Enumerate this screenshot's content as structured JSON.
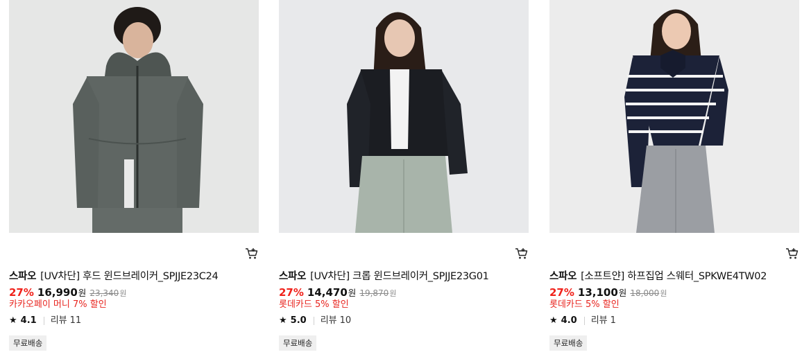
{
  "products": [
    {
      "brand": "스파오",
      "name": "[UV차단] 후드 윈드브레이커_SPJJE23C24",
      "discount": "27%",
      "price": "16,990",
      "currency": "원",
      "original_price": "23,340",
      "original_currency": "원",
      "promo": "카카오페이 머니 7% 할인",
      "rating": "4.1",
      "review_label": "리뷰",
      "review_count": "11",
      "badge": "무료배송",
      "image_desc": "man in grey hooded windbreaker",
      "colors": {
        "bg": "#e6e7e6",
        "jacket": "#5f6663",
        "pants": "#646b68",
        "skin": "#d9b49c",
        "hair": "#1f1a17"
      }
    },
    {
      "brand": "스파오",
      "name": "[UV차단] 크롭 윈드브레이커_SPJJE23G01",
      "discount": "27%",
      "price": "14,470",
      "currency": "원",
      "original_price": "19,870",
      "original_currency": "원",
      "promo": "롯데카드 5% 할인",
      "rating": "5.0",
      "review_label": "리뷰",
      "review_count": "10",
      "badge": "무료배송",
      "image_desc": "woman in black cropped windbreaker",
      "colors": {
        "bg": "#e8e9eb",
        "jacket": "#1b1d22",
        "pants": "#a8b4aa",
        "skin": "#e7c7b3",
        "hair": "#2a1d17"
      }
    },
    {
      "brand": "스파오",
      "name": "[소프트얀] 하프집업 스웨터_SPKWE4TW02",
      "discount": "27%",
      "price": "13,100",
      "currency": "원",
      "original_price": "18,000",
      "original_currency": "원",
      "promo": "롯데카드 5% 할인",
      "rating": "4.0",
      "review_label": "리뷰",
      "review_count": "1",
      "badge": "무료배송",
      "image_desc": "woman in navy striped half-zip sweater",
      "colors": {
        "bg": "#ececec",
        "jacket": "#1c2238",
        "pants": "#9b9ea3",
        "skin": "#ecc9b2",
        "hair": "#2b1e17"
      }
    }
  ],
  "icons": {
    "cart": "cart-icon",
    "star": "star-icon"
  },
  "theme": {
    "accent": "#f0211a",
    "promo": "#e8251f",
    "badge_bg": "#efefef"
  }
}
